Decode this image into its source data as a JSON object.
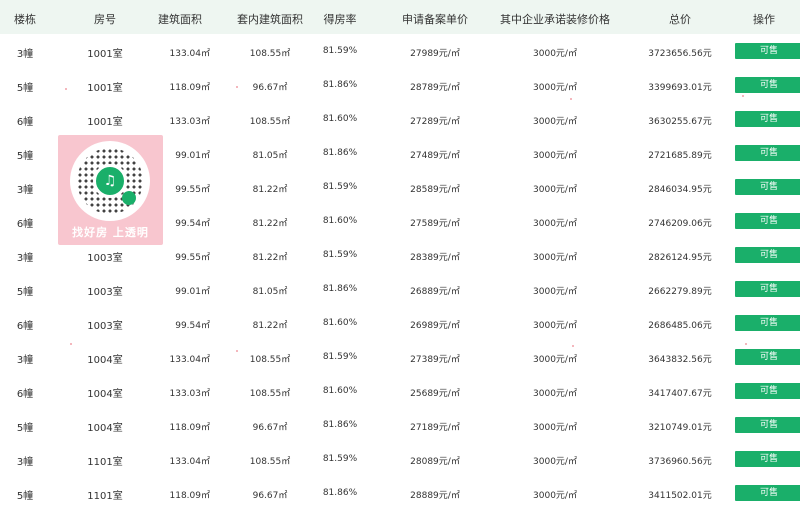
{
  "header": {
    "building": "楼栋",
    "room": "房号",
    "area": "建筑面积",
    "inner_area": "套内建筑面积",
    "rate": "得房率",
    "price": "申请备案单价",
    "decoration": "其中企业承诺装修价格",
    "total": "总价",
    "operation": "操作"
  },
  "rows": [
    {
      "building": "3幢",
      "room": "1001室",
      "area": "133.04㎡",
      "inner_area": "108.55㎡",
      "rate": "81.59%",
      "price": "27989元/㎡",
      "decoration": "3000元/㎡",
      "total": "3723656.56元",
      "action": "可售"
    },
    {
      "building": "5幢",
      "room": "1001室",
      "area": "118.09㎡",
      "inner_area": "96.67㎡",
      "rate": "81.86%",
      "price": "28789元/㎡",
      "decoration": "3000元/㎡",
      "total": "3399693.01元",
      "action": "可售"
    },
    {
      "building": "6幢",
      "room": "1001室",
      "area": "133.03㎡",
      "inner_area": "108.55㎡",
      "rate": "81.60%",
      "price": "27289元/㎡",
      "decoration": "3000元/㎡",
      "total": "3630255.67元",
      "action": "可售"
    },
    {
      "building": "5幢",
      "room": "",
      "area": "99.01㎡",
      "inner_area": "81.05㎡",
      "rate": "81.86%",
      "price": "27489元/㎡",
      "decoration": "3000元/㎡",
      "total": "2721685.89元",
      "action": "可售"
    },
    {
      "building": "3幢",
      "room": "",
      "area": "99.55㎡",
      "inner_area": "81.22㎡",
      "rate": "81.59%",
      "price": "28589元/㎡",
      "decoration": "3000元/㎡",
      "total": "2846034.95元",
      "action": "可售"
    },
    {
      "building": "6幢",
      "room": "",
      "area": "99.54㎡",
      "inner_area": "81.22㎡",
      "rate": "81.60%",
      "price": "27589元/㎡",
      "decoration": "3000元/㎡",
      "total": "2746209.06元",
      "action": "可售"
    },
    {
      "building": "3幢",
      "room": "1003室",
      "area": "99.55㎡",
      "inner_area": "81.22㎡",
      "rate": "81.59%",
      "price": "28389元/㎡",
      "decoration": "3000元/㎡",
      "total": "2826124.95元",
      "action": "可售"
    },
    {
      "building": "5幢",
      "room": "1003室",
      "area": "99.01㎡",
      "inner_area": "81.05㎡",
      "rate": "81.86%",
      "price": "26889元/㎡",
      "decoration": "3000元/㎡",
      "total": "2662279.89元",
      "action": "可售"
    },
    {
      "building": "6幢",
      "room": "1003室",
      "area": "99.54㎡",
      "inner_area": "81.22㎡",
      "rate": "81.60%",
      "price": "26989元/㎡",
      "decoration": "3000元/㎡",
      "total": "2686485.06元",
      "action": "可售"
    },
    {
      "building": "3幢",
      "room": "1004室",
      "area": "133.04㎡",
      "inner_area": "108.55㎡",
      "rate": "81.59%",
      "price": "27389元/㎡",
      "decoration": "3000元/㎡",
      "total": "3643832.56元",
      "action": "可售"
    },
    {
      "building": "6幢",
      "room": "1004室",
      "area": "133.03㎡",
      "inner_area": "108.55㎡",
      "rate": "81.60%",
      "price": "25689元/㎡",
      "decoration": "3000元/㎡",
      "total": "3417407.67元",
      "action": "可售"
    },
    {
      "building": "5幢",
      "room": "1004室",
      "area": "118.09㎡",
      "inner_area": "96.67㎡",
      "rate": "81.86%",
      "price": "27189元/㎡",
      "decoration": "3000元/㎡",
      "total": "3210749.01元",
      "action": "可售"
    },
    {
      "building": "3幢",
      "room": "1101室",
      "area": "133.04㎡",
      "inner_area": "108.55㎡",
      "rate": "81.59%",
      "price": "28089元/㎡",
      "decoration": "3000元/㎡",
      "total": "3736960.56元",
      "action": "可售"
    },
    {
      "building": "5幢",
      "room": "1101室",
      "area": "118.09㎡",
      "inner_area": "96.67㎡",
      "rate": "81.86%",
      "price": "28889元/㎡",
      "decoration": "3000元/㎡",
      "total": "3411502.01元",
      "action": "可售"
    }
  ],
  "promo": {
    "text": "找好房 上透明",
    "qr_icon": "miniprogram-qr-icon",
    "accent": "#1aaf6a",
    "card_color": "#f8c6cf"
  },
  "colors": {
    "header_bg": "#eef6f1",
    "button_bg": "#1aaf6a"
  }
}
